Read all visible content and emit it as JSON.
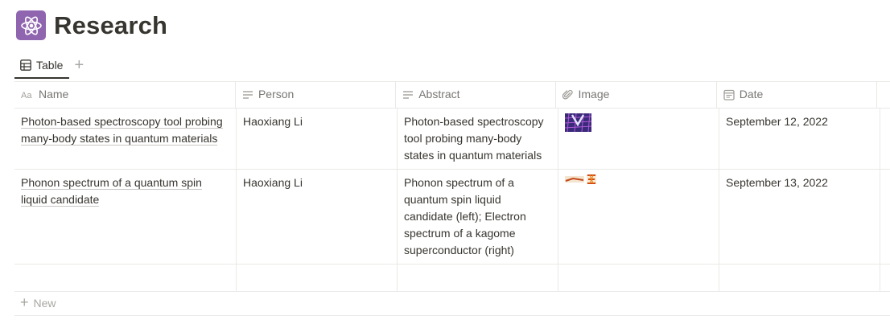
{
  "page": {
    "title": "Research",
    "icon": "atom-icon",
    "icon_bg": "#9065b0"
  },
  "views": {
    "tabs": [
      {
        "label": "Table",
        "icon": "table-icon"
      }
    ],
    "add_label": "+"
  },
  "table": {
    "columns": [
      {
        "label": "Name",
        "icon": "title-aa-icon"
      },
      {
        "label": "Person",
        "icon": "text-lines-icon"
      },
      {
        "label": "Abstract",
        "icon": "text-lines-icon"
      },
      {
        "label": "Image",
        "icon": "paperclip-icon"
      },
      {
        "label": "Date",
        "icon": "calendar-icon"
      }
    ],
    "rows": [
      {
        "name": "Photon-based spectroscopy tool probing many-body states in quantum materials",
        "person": "Haoxiang Li",
        "abstract": "Photon-based spectroscopy tool probing many-body states in quantum materials",
        "image": "thumbnail-lattice",
        "date": "September 12, 2022"
      },
      {
        "name": "Phonon spectrum of a quantum spin liquid candidate",
        "person": "Haoxiang Li",
        "abstract": "Phonon spectrum of a quantum spin liquid candidate (left); Electron spectrum of a kagome superconductor (right)",
        "image": "thumbnail-spectrum",
        "date": "September 13, 2022"
      }
    ],
    "new_label": "New"
  }
}
